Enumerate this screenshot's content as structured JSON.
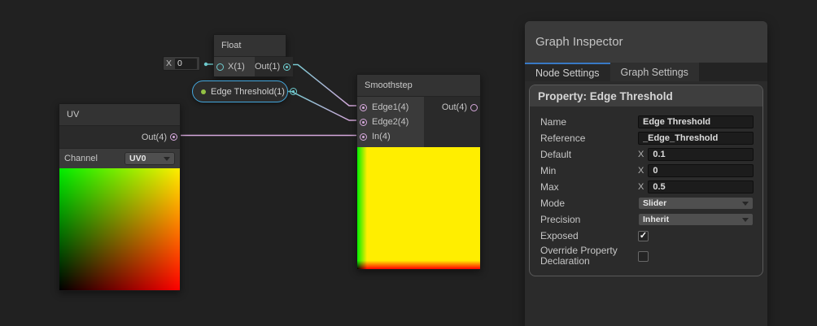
{
  "canvas": {
    "float_node": {
      "title": "Float",
      "input_label": "X(1)",
      "output_label": "Out(1)",
      "field_label": "X",
      "field_value": "0"
    },
    "property_node": {
      "label": "Edge Threshold(1)"
    },
    "uv_node": {
      "title": "UV",
      "output_label": "Out(4)",
      "channel_label": "Channel",
      "channel_value": "UV0"
    },
    "smoothstep_node": {
      "title": "Smoothstep",
      "inputs": [
        "Edge1(4)",
        "Edge2(4)",
        "In(4)"
      ],
      "output_label": "Out(4)"
    },
    "wire_colors": {
      "vector1": "#6ecbce",
      "vector4": "#d6a8dc",
      "selection": "#44a7dd",
      "exposed_dot": "#93c144"
    }
  },
  "inspector": {
    "title": "Graph Inspector",
    "tabs": {
      "node_settings": "Node Settings",
      "graph_settings": "Graph Settings"
    },
    "property_header": "Property: Edge Threshold",
    "rows": {
      "name": {
        "label": "Name",
        "value": "Edge Threshold"
      },
      "reference": {
        "label": "Reference",
        "value": "_Edge_Threshold"
      },
      "default": {
        "label": "Default",
        "axis": "X",
        "value": "0.1"
      },
      "min": {
        "label": "Min",
        "axis": "X",
        "value": "0"
      },
      "max": {
        "label": "Max",
        "axis": "X",
        "value": "0.5"
      },
      "mode": {
        "label": "Mode",
        "value": "Slider"
      },
      "precision": {
        "label": "Precision",
        "value": "Inherit"
      },
      "exposed": {
        "label": "Exposed",
        "checked": true,
        "check_glyph": "✓"
      },
      "override": {
        "label": "Override Property Declaration",
        "checked": false,
        "check_glyph": ""
      }
    }
  }
}
